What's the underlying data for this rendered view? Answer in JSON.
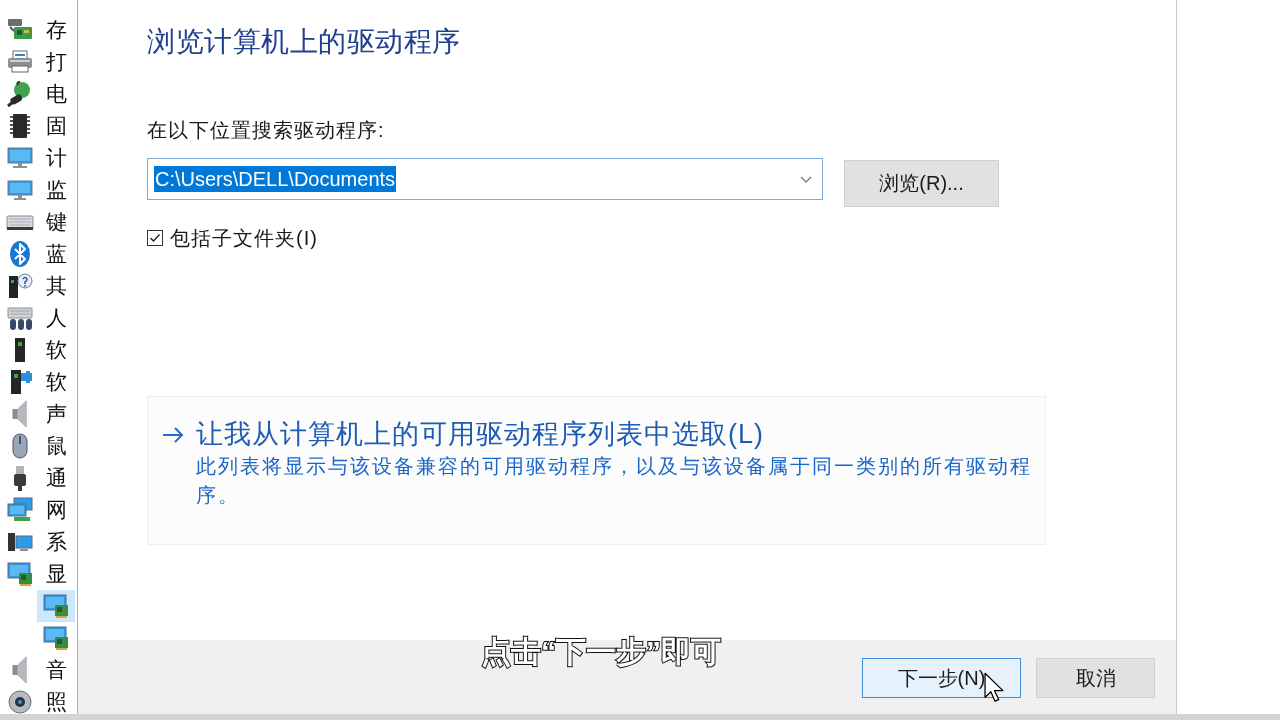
{
  "device_tree": [
    {
      "kind": "storage",
      "label": "存",
      "selected": false
    },
    {
      "kind": "printer",
      "label": "打",
      "selected": false
    },
    {
      "kind": "battery",
      "label": "电",
      "selected": false
    },
    {
      "kind": "firmware",
      "label": "固",
      "selected": false
    },
    {
      "kind": "computer",
      "label": "计",
      "selected": false
    },
    {
      "kind": "monitor",
      "label": "监",
      "selected": false
    },
    {
      "kind": "keyboard",
      "label": "键",
      "selected": false
    },
    {
      "kind": "bluetooth",
      "label": "蓝",
      "selected": false
    },
    {
      "kind": "other",
      "label": "其",
      "selected": false
    },
    {
      "kind": "hid",
      "label": "人",
      "selected": false
    },
    {
      "kind": "software",
      "label": "软",
      "selected": false
    },
    {
      "kind": "component",
      "label": "软",
      "selected": false
    },
    {
      "kind": "sound",
      "label": "声",
      "selected": false
    },
    {
      "kind": "mouse",
      "label": "鼠",
      "selected": false
    },
    {
      "kind": "usb",
      "label": "通",
      "selected": false
    },
    {
      "kind": "network",
      "label": "网",
      "selected": false
    },
    {
      "kind": "system",
      "label": "系",
      "selected": false
    },
    {
      "kind": "display",
      "label": "显",
      "selected": false,
      "children": [
        {
          "kind": "adapter",
          "selected": true
        },
        {
          "kind": "adapter",
          "selected": false
        }
      ]
    },
    {
      "kind": "sound",
      "label": "音",
      "selected": false
    },
    {
      "kind": "camera",
      "label": "照",
      "selected": false
    }
  ],
  "dialog": {
    "title": "浏览计算机上的驱动程序",
    "search_label": "在以下位置搜索驱动程序:",
    "path_field": {
      "value": "C:\\Users\\DELL\\Documents",
      "focused": true,
      "text_selected": true
    },
    "browse_button": "浏览(R)...",
    "include_subfolders": {
      "label": "包括子文件夹(I)",
      "checked": true
    },
    "pick_option": {
      "title": "让我从计算机上的可用驱动程序列表中选取(L)",
      "description": "此列表将显示与该设备兼容的可用驱动程序，以及与该设备属于同一类别的所有驱动程序。"
    },
    "buttons": [
      {
        "label": "下一步(N)",
        "default": true
      },
      {
        "label": "取消",
        "default": false
      }
    ]
  },
  "caption": "点击“下一步”即可"
}
